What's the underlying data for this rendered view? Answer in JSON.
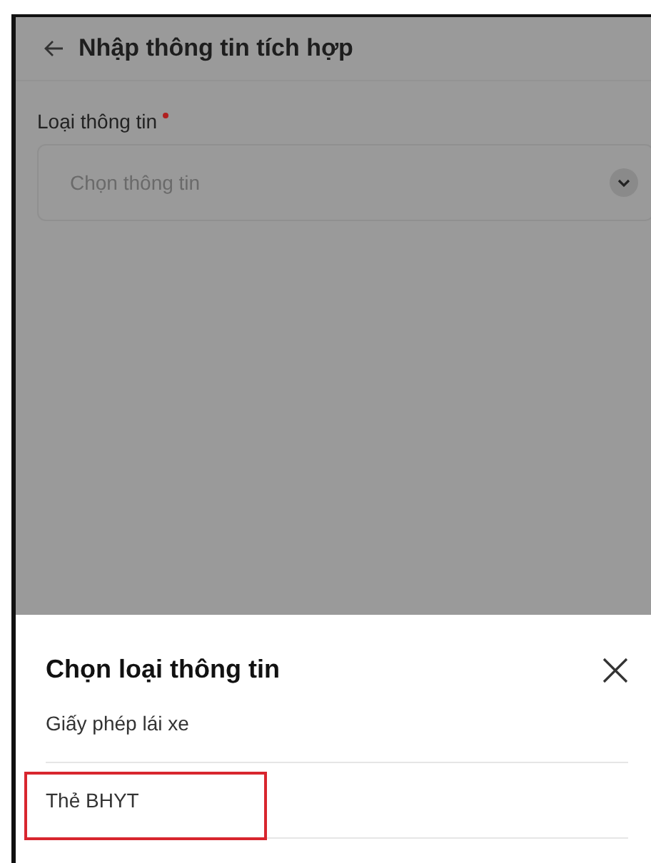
{
  "header": {
    "title": "Nhập thông tin tích hợp"
  },
  "form": {
    "label": "Loại thông tin",
    "required": true,
    "select": {
      "placeholder": "Chọn thông tin"
    }
  },
  "sheet": {
    "title": "Chọn loại thông tin",
    "items": [
      {
        "label": "Giấy phép lái xe",
        "highlighted": false
      },
      {
        "label": "Thẻ BHYT",
        "highlighted": true
      }
    ]
  }
}
